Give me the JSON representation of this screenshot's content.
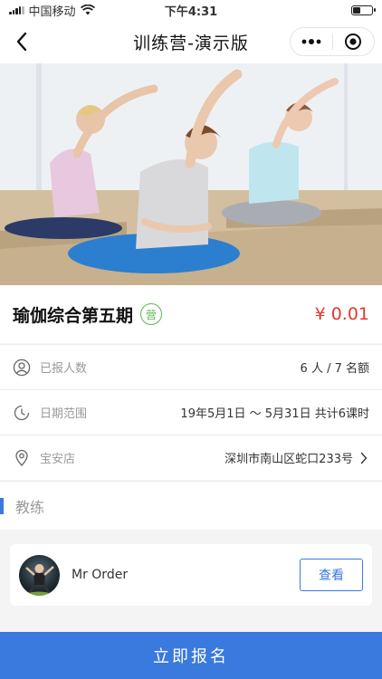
{
  "status_bar": {
    "carrier": "中国移动",
    "time": "下午4:31"
  },
  "nav": {
    "title": "训练营-演示版"
  },
  "course": {
    "name": "瑜伽综合第五期",
    "badge": "营",
    "price": "¥ 0.01"
  },
  "info_rows": [
    {
      "icon": "user-icon",
      "label": "已报人数",
      "value": "6 人 / 7 名额"
    },
    {
      "icon": "clock-icon",
      "label": "日期范围",
      "value": "19年5月1日 ～ 5月31日 共计6课时"
    },
    {
      "icon": "location-pin-icon",
      "label": "宝安店",
      "value": "深圳市南山区蛇口233号"
    }
  ],
  "coach_section": {
    "title": "教练",
    "coach_name": "Mr Order",
    "view_label": "查看"
  },
  "cta": {
    "label": "立即报名"
  },
  "colors": {
    "primary": "#3a79dd",
    "price": "#e03a2f",
    "badge": "#57b84d"
  }
}
